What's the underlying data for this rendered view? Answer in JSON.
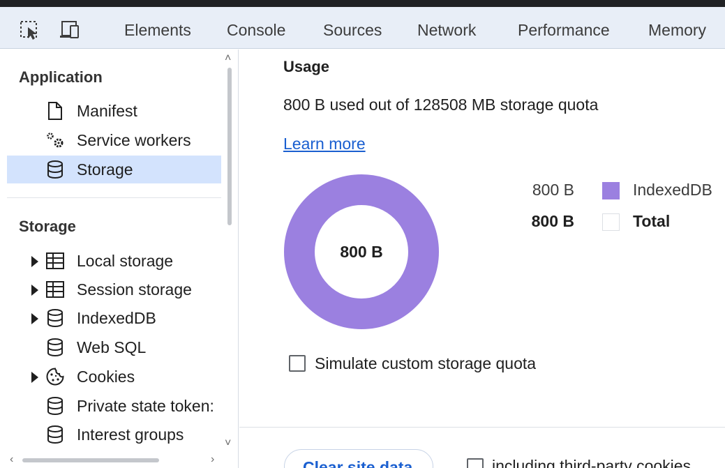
{
  "toolbar": {
    "icons": [
      "inspect-element-icon",
      "device-toolbar-icon"
    ],
    "tabs": [
      "Elements",
      "Console",
      "Sources",
      "Network",
      "Performance",
      "Memory"
    ]
  },
  "sidebar": {
    "application_title": "Application",
    "application_items": [
      {
        "label": "Manifest",
        "icon": "document-icon"
      },
      {
        "label": "Service workers",
        "icon": "gears-icon"
      },
      {
        "label": "Storage",
        "icon": "database-icon",
        "selected": true
      }
    ],
    "storage_title": "Storage",
    "storage_items": [
      {
        "label": "Local storage",
        "icon": "table-icon",
        "expandable": true
      },
      {
        "label": "Session storage",
        "icon": "table-icon",
        "expandable": true
      },
      {
        "label": "IndexedDB",
        "icon": "database-icon",
        "expandable": true
      },
      {
        "label": "Web SQL",
        "icon": "database-icon",
        "expandable": false
      },
      {
        "label": "Cookies",
        "icon": "cookie-icon",
        "expandable": true
      },
      {
        "label": "Private state token:",
        "icon": "database-icon",
        "expandable": false
      },
      {
        "label": "Interest groups",
        "icon": "database-icon",
        "expandable": false
      }
    ]
  },
  "main": {
    "usage_title": "Usage",
    "usage_text": "800 B used out of 128508 MB storage quota",
    "learn_more": "Learn more",
    "donut_center": "800 B",
    "donut_color": "#9b80e0",
    "legend": [
      {
        "value": "800 B",
        "label": "IndexedDB",
        "color": "#9b80e0",
        "bold": false
      },
      {
        "value": "800 B",
        "label": "Total",
        "color": "#ffffff",
        "bold": true
      }
    ],
    "simulate_label": "Simulate custom storage quota",
    "simulate_checked": false,
    "clear_button": "Clear site data",
    "third_party_label": "including third-party cookies"
  }
}
